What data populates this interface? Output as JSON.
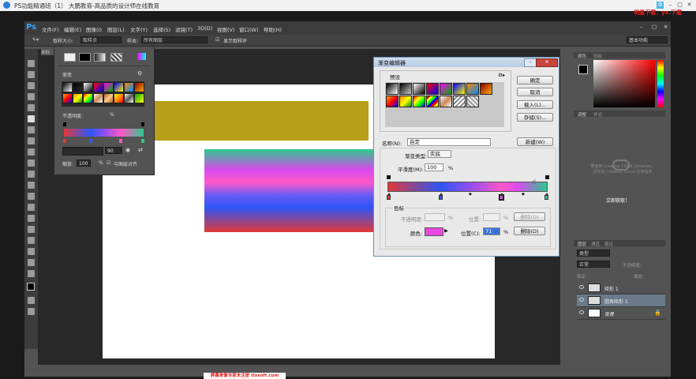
{
  "player": {
    "title": "PS功能精通班（1） 大鹏教育-高品质的设计师在线教育",
    "watermark_top": "明星下载：yx.下载"
  },
  "menubar": {
    "items": [
      "文件(F)",
      "编辑(E)",
      "图像(I)",
      "图层(L)",
      "文字(Y)",
      "选择(S)",
      "滤镜(T)",
      "3D(D)",
      "视图(V)",
      "窗口(W)",
      "帮助(H)"
    ]
  },
  "options": {
    "sample_size_label": "取样大小:",
    "sample_size_value": "取样点",
    "sample_label": "样本:",
    "sample_value": "所有图层",
    "show_ring_label": "显示取样环",
    "workspace": "基本功能"
  },
  "doc_tab": "未标",
  "gradient_picker": {
    "section_label": "渐变",
    "opacity_label": "不透明度:",
    "opacity_unit": "%",
    "angle_value": "90",
    "scale_label": "缩放:",
    "scale_value": "100",
    "scale_unit": "%",
    "align_label": "与图层对齐"
  },
  "right_panels": {
    "color_tabs": [
      "颜色",
      "色板"
    ],
    "adjust_tabs": [
      "调整",
      "样式"
    ],
    "libraries_text_1": "要使用 Creative Cloud Libraries，",
    "libraries_text_2": "请安装 Creative Cloud 应用程序",
    "libraries_button": "立即获取！",
    "layer_tabs": [
      "图层",
      "通道",
      "路径"
    ],
    "kind_label": "类型",
    "blend_mode": "正常",
    "opacity_label": "不透明度:",
    "lock_label": "锁定:",
    "fill_label": "填充:",
    "layers": [
      {
        "name": "矩形 1"
      },
      {
        "name": "圆角矩形 1"
      },
      {
        "name": "背景"
      }
    ]
  },
  "gradient_editor": {
    "title": "渐变编辑器",
    "presets_label": "预设",
    "ok_label": "确定",
    "cancel_label": "取消",
    "load_label": "载入(L)...",
    "save_label": "存储(S)...",
    "name_label": "名称(N):",
    "name_value": "自定",
    "new_label": "新建(W)",
    "type_label": "渐变类型:",
    "type_value": "实底",
    "smooth_label": "平滑度(M):",
    "smooth_value": "100",
    "smooth_unit": "%",
    "stops_label": "色标",
    "opacity_label": "不透明度:",
    "opacity_unit": "%",
    "location_label": "位置:",
    "location_unit": "%",
    "delete_label": "删除(D)",
    "color_label": "颜色:",
    "color_value": "#e84ae0",
    "color_location_label": "位置(C):",
    "color_location_value": "71",
    "color_location_unit": "%",
    "delete2_label": "删除(D)"
  },
  "watermark_bottom": "屏幕录像专家未注册 tlxsoft.com"
}
